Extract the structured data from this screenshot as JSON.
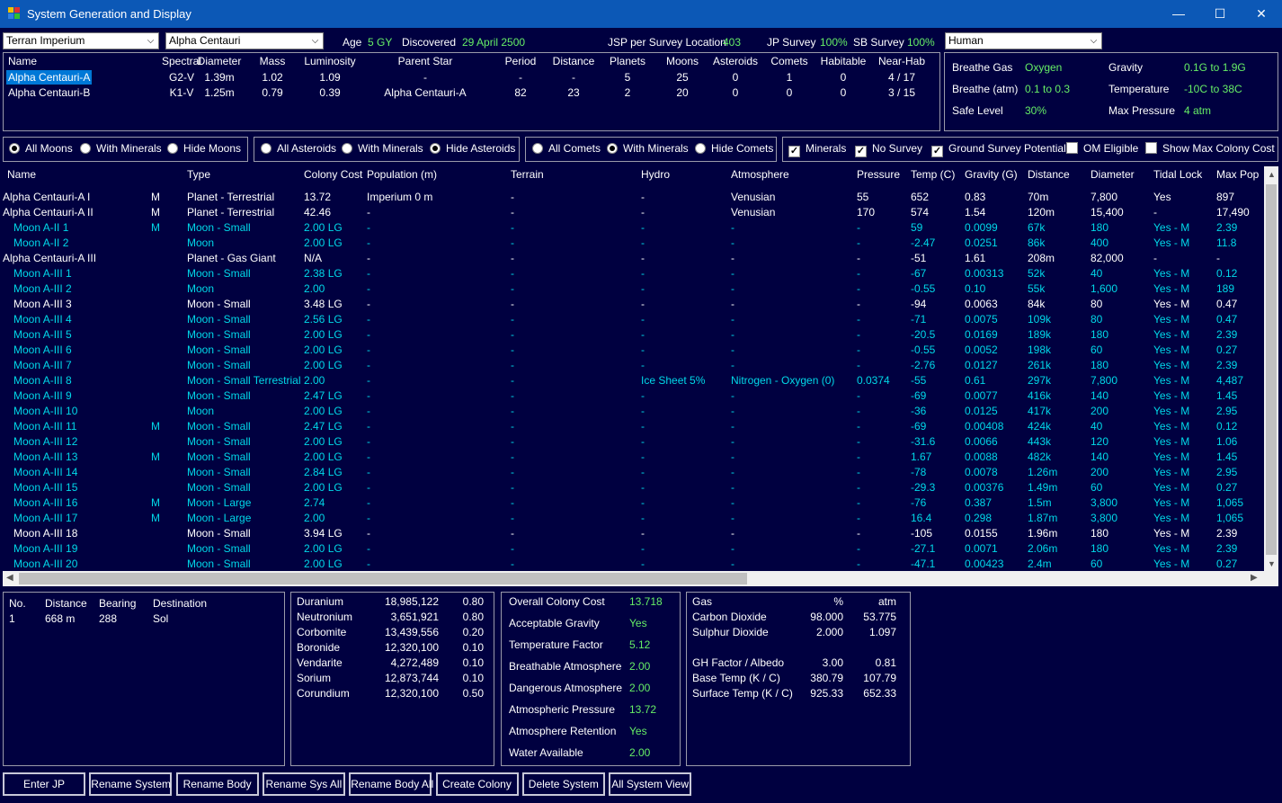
{
  "window": {
    "title": "System Generation and Display"
  },
  "top": {
    "race_select": "Terran Imperium",
    "system_select": "Alpha Centauri",
    "age_label": "Age",
    "age_value": "5 GY",
    "discovered_label": "Discovered",
    "discovered_value": "29 April 2500",
    "jsp_label": "JSP per Survey Location",
    "jsp_value": "403",
    "jp_survey_label": "JP Survey",
    "jp_survey_value": "100%",
    "sb_survey_label": "SB Survey",
    "sb_survey_value": "100%",
    "species_select": "Human"
  },
  "stars": {
    "headers": [
      "Name",
      "Spectral",
      "Diameter",
      "Mass",
      "Luminosity",
      "Parent Star",
      "Period",
      "Distance",
      "Planets",
      "Moons",
      "Asteroids",
      "Comets",
      "Habitable",
      "Near-Hab"
    ],
    "rows": [
      [
        "Alpha Centauri-A",
        "G2-V",
        "1.39m",
        "1.02",
        "1.09",
        "-",
        "-",
        "-",
        "5",
        "25",
        "0",
        "1",
        "0",
        "4 / 17"
      ],
      [
        "Alpha Centauri-B",
        "K1-V",
        "1.25m",
        "0.79",
        "0.39",
        "Alpha Centauri-A",
        "82",
        "23",
        "2",
        "20",
        "0",
        "0",
        "0",
        "3 / 15"
      ]
    ]
  },
  "species": {
    "breathe_gas_label": "Breathe Gas",
    "breathe_gas_value": "Oxygen",
    "gravity_label": "Gravity",
    "gravity_value": "0.1G  to  1.9G",
    "breathe_atm_label": "Breathe (atm)",
    "breathe_atm_value": "0.1  to  0.3",
    "temperature_label": "Temperature",
    "temperature_value": "-10C  to  38C",
    "safe_level_label": "Safe Level",
    "safe_level_value": "30%",
    "max_pressure_label": "Max Pressure",
    "max_pressure_value": "4 atm"
  },
  "filters": {
    "moons": [
      "All Moons",
      "With Minerals",
      "Hide Moons"
    ],
    "asteroids": [
      "All Asteroids",
      "With Minerals",
      "Hide Asteroids"
    ],
    "comets": [
      "All Comets",
      "With Minerals",
      "Hide Comets"
    ],
    "checks": [
      "Minerals",
      "No Survey",
      "Ground Survey Potential",
      "OM Eligible",
      "Show Max Colony Cost"
    ]
  },
  "bodies": {
    "headers": [
      "Name",
      "Type",
      "Colony Cost",
      "Population (m)",
      "Terrain",
      "Hydro",
      "Atmosphere",
      "Pressure",
      "Temp (C)",
      "Gravity (G)",
      "Distance",
      "Diameter",
      "Tidal Lock",
      "Max Pop"
    ],
    "rows": [
      {
        "name": "Alpha Centauri-A I",
        "m": "M",
        "type": "Planet - Terrestrial",
        "cost": "13.72",
        "pop": "Imperium 0 m",
        "terrain": "-",
        "hydro": "-",
        "atmo": "Venusian",
        "pressure": "55",
        "temp": "652",
        "grav": "0.83",
        "dist": "70m",
        "diam": "7,800",
        "tidal": "Yes",
        "maxpop": "897",
        "style": "w"
      },
      {
        "name": "Alpha Centauri-A II",
        "m": "M",
        "type": "Planet - Terrestrial",
        "cost": "42.46",
        "pop": "-",
        "terrain": "-",
        "hydro": "-",
        "atmo": "Venusian",
        "pressure": "170",
        "temp": "574",
        "grav": "1.54",
        "dist": "120m",
        "diam": "15,400",
        "tidal": "-",
        "maxpop": "17,490",
        "style": "w"
      },
      {
        "name": "Moon A-II 1",
        "m": "M",
        "type": "Moon - Small",
        "cost": "2.00 LG",
        "pop": "-",
        "terrain": "-",
        "hydro": "-",
        "atmo": "-",
        "pressure": "-",
        "temp": "59",
        "grav": "0.0099",
        "dist": "67k",
        "diam": "180",
        "tidal": "Yes - M",
        "maxpop": "2.39",
        "style": "c"
      },
      {
        "name": "Moon A-II 2",
        "m": "",
        "type": "Moon",
        "cost": "2.00 LG",
        "pop": "-",
        "terrain": "-",
        "hydro": "-",
        "atmo": "-",
        "pressure": "-",
        "temp": "-2.47",
        "grav": "0.0251",
        "dist": "86k",
        "diam": "400",
        "tidal": "Yes - M",
        "maxpop": "11.8",
        "style": "c"
      },
      {
        "name": "Alpha Centauri-A III",
        "m": "",
        "type": "Planet - Gas Giant",
        "cost": "N/A",
        "pop": "-",
        "terrain": "-",
        "hydro": "-",
        "atmo": "-",
        "pressure": "-",
        "temp": "-51",
        "grav": "1.61",
        "dist": "208m",
        "diam": "82,000",
        "tidal": "-",
        "maxpop": "-",
        "style": "w"
      },
      {
        "name": "Moon A-III 1",
        "m": "",
        "type": "Moon - Small",
        "cost": "2.38 LG",
        "pop": "-",
        "terrain": "-",
        "hydro": "-",
        "atmo": "-",
        "pressure": "-",
        "temp": "-67",
        "grav": "0.00313",
        "dist": "52k",
        "diam": "40",
        "tidal": "Yes - M",
        "maxpop": "0.12",
        "style": "c"
      },
      {
        "name": "Moon A-III 2",
        "m": "",
        "type": "Moon",
        "cost": "2.00",
        "pop": "-",
        "terrain": "-",
        "hydro": "-",
        "atmo": "-",
        "pressure": "-",
        "temp": "-0.55",
        "grav": "0.10",
        "dist": "55k",
        "diam": "1,600",
        "tidal": "Yes - M",
        "maxpop": "189",
        "style": "c"
      },
      {
        "name": "Moon A-III 3",
        "m": "",
        "type": "Moon - Small",
        "cost": "3.48 LG",
        "pop": "-",
        "terrain": "-",
        "hydro": "-",
        "atmo": "-",
        "pressure": "-",
        "temp": "-94",
        "grav": "0.0063",
        "dist": "84k",
        "diam": "80",
        "tidal": "Yes - M",
        "maxpop": "0.47",
        "style": "w"
      },
      {
        "name": "Moon A-III 4",
        "m": "",
        "type": "Moon - Small",
        "cost": "2.56 LG",
        "pop": "-",
        "terrain": "-",
        "hydro": "-",
        "atmo": "-",
        "pressure": "-",
        "temp": "-71",
        "grav": "0.0075",
        "dist": "109k",
        "diam": "80",
        "tidal": "Yes - M",
        "maxpop": "0.47",
        "style": "c"
      },
      {
        "name": "Moon A-III 5",
        "m": "",
        "type": "Moon - Small",
        "cost": "2.00 LG",
        "pop": "-",
        "terrain": "-",
        "hydro": "-",
        "atmo": "-",
        "pressure": "-",
        "temp": "-20.5",
        "grav": "0.0169",
        "dist": "189k",
        "diam": "180",
        "tidal": "Yes - M",
        "maxpop": "2.39",
        "style": "c"
      },
      {
        "name": "Moon A-III 6",
        "m": "",
        "type": "Moon - Small",
        "cost": "2.00 LG",
        "pop": "-",
        "terrain": "-",
        "hydro": "-",
        "atmo": "-",
        "pressure": "-",
        "temp": "-0.55",
        "grav": "0.0052",
        "dist": "198k",
        "diam": "60",
        "tidal": "Yes - M",
        "maxpop": "0.27",
        "style": "c"
      },
      {
        "name": "Moon A-III 7",
        "m": "",
        "type": "Moon - Small",
        "cost": "2.00 LG",
        "pop": "-",
        "terrain": "-",
        "hydro": "-",
        "atmo": "-",
        "pressure": "-",
        "temp": "-2.76",
        "grav": "0.0127",
        "dist": "261k",
        "diam": "180",
        "tidal": "Yes - M",
        "maxpop": "2.39",
        "style": "c"
      },
      {
        "name": "Moon A-III 8",
        "m": "",
        "type": "Moon - Small Terrestrial",
        "cost": "2.00",
        "pop": "-",
        "terrain": "-",
        "hydro": "Ice Sheet 5%",
        "atmo": "Nitrogen - Oxygen (0)",
        "pressure": "0.0374",
        "temp": "-55",
        "grav": "0.61",
        "dist": "297k",
        "diam": "7,800",
        "tidal": "Yes - M",
        "maxpop": "4,487",
        "style": "c"
      },
      {
        "name": "Moon A-III 9",
        "m": "",
        "type": "Moon - Small",
        "cost": "2.47 LG",
        "pop": "-",
        "terrain": "-",
        "hydro": "-",
        "atmo": "-",
        "pressure": "-",
        "temp": "-69",
        "grav": "0.0077",
        "dist": "416k",
        "diam": "140",
        "tidal": "Yes - M",
        "maxpop": "1.45",
        "style": "c"
      },
      {
        "name": "Moon A-III 10",
        "m": "",
        "type": "Moon",
        "cost": "2.00 LG",
        "pop": "-",
        "terrain": "-",
        "hydro": "-",
        "atmo": "-",
        "pressure": "-",
        "temp": "-36",
        "grav": "0.0125",
        "dist": "417k",
        "diam": "200",
        "tidal": "Yes - M",
        "maxpop": "2.95",
        "style": "c"
      },
      {
        "name": "Moon A-III 11",
        "m": "M",
        "type": "Moon - Small",
        "cost": "2.47 LG",
        "pop": "-",
        "terrain": "-",
        "hydro": "-",
        "atmo": "-",
        "pressure": "-",
        "temp": "-69",
        "grav": "0.00408",
        "dist": "424k",
        "diam": "40",
        "tidal": "Yes - M",
        "maxpop": "0.12",
        "style": "c"
      },
      {
        "name": "Moon A-III 12",
        "m": "",
        "type": "Moon - Small",
        "cost": "2.00 LG",
        "pop": "-",
        "terrain": "-",
        "hydro": "-",
        "atmo": "-",
        "pressure": "-",
        "temp": "-31.6",
        "grav": "0.0066",
        "dist": "443k",
        "diam": "120",
        "tidal": "Yes - M",
        "maxpop": "1.06",
        "style": "c"
      },
      {
        "name": "Moon A-III 13",
        "m": "M",
        "type": "Moon - Small",
        "cost": "2.00 LG",
        "pop": "-",
        "terrain": "-",
        "hydro": "-",
        "atmo": "-",
        "pressure": "-",
        "temp": "1.67",
        "grav": "0.0088",
        "dist": "482k",
        "diam": "140",
        "tidal": "Yes - M",
        "maxpop": "1.45",
        "style": "c"
      },
      {
        "name": "Moon A-III 14",
        "m": "",
        "type": "Moon - Small",
        "cost": "2.84 LG",
        "pop": "-",
        "terrain": "-",
        "hydro": "-",
        "atmo": "-",
        "pressure": "-",
        "temp": "-78",
        "grav": "0.0078",
        "dist": "1.26m",
        "diam": "200",
        "tidal": "Yes - M",
        "maxpop": "2.95",
        "style": "c"
      },
      {
        "name": "Moon A-III 15",
        "m": "",
        "type": "Moon - Small",
        "cost": "2.00 LG",
        "pop": "-",
        "terrain": "-",
        "hydro": "-",
        "atmo": "-",
        "pressure": "-",
        "temp": "-29.3",
        "grav": "0.00376",
        "dist": "1.49m",
        "diam": "60",
        "tidal": "Yes - M",
        "maxpop": "0.27",
        "style": "c"
      },
      {
        "name": "Moon A-III 16",
        "m": "M",
        "type": "Moon - Large",
        "cost": "2.74",
        "pop": "-",
        "terrain": "-",
        "hydro": "-",
        "atmo": "-",
        "pressure": "-",
        "temp": "-76",
        "grav": "0.387",
        "dist": "1.5m",
        "diam": "3,800",
        "tidal": "Yes - M",
        "maxpop": "1,065",
        "style": "c"
      },
      {
        "name": "Moon A-III 17",
        "m": "M",
        "type": "Moon - Large",
        "cost": "2.00",
        "pop": "-",
        "terrain": "-",
        "hydro": "-",
        "atmo": "-",
        "pressure": "-",
        "temp": "16.4",
        "grav": "0.298",
        "dist": "1.87m",
        "diam": "3,800",
        "tidal": "Yes - M",
        "maxpop": "1,065",
        "style": "c"
      },
      {
        "name": "Moon A-III 18",
        "m": "",
        "type": "Moon - Small",
        "cost": "3.94 LG",
        "pop": "-",
        "terrain": "-",
        "hydro": "-",
        "atmo": "-",
        "pressure": "-",
        "temp": "-105",
        "grav": "0.0155",
        "dist": "1.96m",
        "diam": "180",
        "tidal": "Yes - M",
        "maxpop": "2.39",
        "style": "w"
      },
      {
        "name": "Moon A-III 19",
        "m": "",
        "type": "Moon - Small",
        "cost": "2.00 LG",
        "pop": "-",
        "terrain": "-",
        "hydro": "-",
        "atmo": "-",
        "pressure": "-",
        "temp": "-27.1",
        "grav": "0.0071",
        "dist": "2.06m",
        "diam": "180",
        "tidal": "Yes - M",
        "maxpop": "2.39",
        "style": "c"
      },
      {
        "name": "Moon A-III 20",
        "m": "",
        "type": "Moon - Small",
        "cost": "2.00 LG",
        "pop": "-",
        "terrain": "-",
        "hydro": "-",
        "atmo": "-",
        "pressure": "-",
        "temp": "-47.1",
        "grav": "0.00423",
        "dist": "2.4m",
        "diam": "60",
        "tidal": "Yes - M",
        "maxpop": "0.27",
        "style": "c"
      }
    ]
  },
  "jump_points": {
    "headers": [
      "No.",
      "Distance",
      "Bearing",
      "Destination"
    ],
    "rows": [
      [
        "1",
        "668 m",
        "288",
        "Sol"
      ]
    ]
  },
  "minerals": {
    "rows": [
      [
        "Duranium",
        "18,985,122",
        "0.80"
      ],
      [
        "Neutronium",
        "3,651,921",
        "0.80"
      ],
      [
        "Corbomite",
        "13,439,556",
        "0.20"
      ],
      [
        "Boronide",
        "12,320,100",
        "0.10"
      ],
      [
        "Vendarite",
        "4,272,489",
        "0.10"
      ],
      [
        "Sorium",
        "12,873,744",
        "0.10"
      ],
      [
        "Corundium",
        "12,320,100",
        "0.50"
      ]
    ]
  },
  "colony": {
    "rows": [
      [
        "Overall Colony Cost",
        "13.718"
      ],
      [
        "Acceptable Gravity",
        "Yes"
      ],
      [
        "Temperature Factor",
        "5.12"
      ],
      [
        "Breathable Atmosphere",
        "2.00"
      ],
      [
        "Dangerous Atmosphere",
        "2.00"
      ],
      [
        "Atmospheric Pressure",
        "13.72"
      ],
      [
        "Atmosphere Retention",
        "Yes"
      ],
      [
        "Water Available",
        "2.00"
      ]
    ]
  },
  "atmosphere": {
    "headers": [
      "Gas",
      "%",
      "atm"
    ],
    "gases": [
      [
        "Carbon Dioxide",
        "98.000",
        "53.775"
      ],
      [
        "Sulphur Dioxide",
        "2.000",
        "1.097"
      ]
    ],
    "stats": [
      [
        "GH Factor / Albedo",
        "3.00",
        "0.81"
      ],
      [
        "Base Temp (K / C)",
        "380.79",
        "107.79"
      ],
      [
        "Surface Temp (K / C)",
        "925.33",
        "652.33"
      ]
    ]
  },
  "buttons": [
    "Enter JP",
    "Rename System",
    "Rename Body",
    "Rename Sys All",
    "Rename Body All",
    "Create Colony",
    "Delete System",
    "All System View"
  ],
  "colors": {
    "bg": "#000040",
    "accent_green": "#66ee66",
    "moon_cyan": "#00d8e8",
    "titlebar": "#0c58b6",
    "selection": "#0078d7"
  }
}
